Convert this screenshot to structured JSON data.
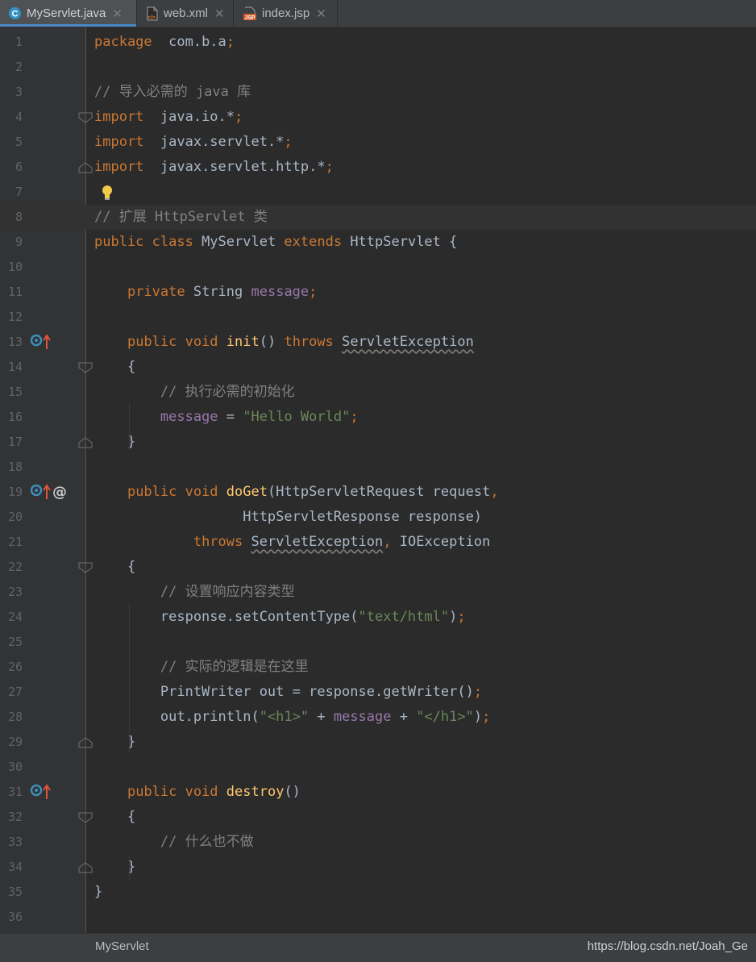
{
  "tabs": [
    {
      "label": "MyServlet.java",
      "icon": "java-class-icon",
      "active": true
    },
    {
      "label": "web.xml",
      "icon": "xml-file-icon",
      "active": false
    },
    {
      "label": "index.jsp",
      "icon": "jsp-file-icon",
      "active": false
    }
  ],
  "editor": {
    "line_numbers": [
      "1",
      "2",
      "3",
      "4",
      "5",
      "6",
      "7",
      "8",
      "9",
      "10",
      "11",
      "12",
      "13",
      "14",
      "15",
      "16",
      "17",
      "18",
      "19",
      "20",
      "21",
      "22",
      "23",
      "24",
      "25",
      "26",
      "27",
      "28",
      "29",
      "30",
      "31",
      "32",
      "33",
      "34",
      "35",
      "36"
    ],
    "current_line": 8,
    "lines": [
      [
        [
          "kw",
          "package"
        ],
        [
          "",
          "  com.b.a"
        ],
        [
          "kw",
          ";"
        ]
      ],
      [],
      [
        [
          "cm",
          "// 导入必需的 java 库"
        ]
      ],
      [
        [
          "kw",
          "import"
        ],
        [
          "",
          "  java.io.*"
        ],
        [
          "kw",
          ";"
        ]
      ],
      [
        [
          "kw",
          "import"
        ],
        [
          "",
          "  javax.servlet.*"
        ],
        [
          "kw",
          ";"
        ]
      ],
      [
        [
          "kw",
          "import"
        ],
        [
          "",
          "  javax.servlet.http.*"
        ],
        [
          "kw",
          ";"
        ]
      ],
      [],
      [
        [
          "cm",
          "// 扩展 HttpServlet 类"
        ]
      ],
      [
        [
          "kw",
          "public class "
        ],
        [
          "",
          "MyServlet "
        ],
        [
          "kw",
          "extends "
        ],
        [
          "",
          "HttpServlet {"
        ]
      ],
      [],
      [
        [
          "",
          "    "
        ],
        [
          "kw",
          "private "
        ],
        [
          "",
          "String "
        ],
        [
          "fld",
          "message"
        ],
        [
          "kw",
          ";"
        ]
      ],
      [],
      [
        [
          "",
          "    "
        ],
        [
          "kw",
          "public void "
        ],
        [
          "fn",
          "init"
        ],
        [
          "",
          "() "
        ],
        [
          "kw",
          "throws "
        ],
        [
          "sq",
          "ServletException"
        ]
      ],
      [
        [
          "",
          "    {"
        ]
      ],
      [
        [
          "",
          "        "
        ],
        [
          "cm",
          "// 执行必需的初始化"
        ]
      ],
      [
        [
          "",
          "        "
        ],
        [
          "fld",
          "message"
        ],
        [
          "",
          " = "
        ],
        [
          "str",
          "\"Hello World\""
        ],
        [
          "kw",
          ";"
        ]
      ],
      [
        [
          "",
          "    }"
        ]
      ],
      [],
      [
        [
          "",
          "    "
        ],
        [
          "kw",
          "public void "
        ],
        [
          "fn",
          "doGet"
        ],
        [
          "",
          "(HttpServletRequest request"
        ],
        [
          "kw",
          ","
        ]
      ],
      [
        [
          "",
          "                  HttpServletResponse response)"
        ]
      ],
      [
        [
          "",
          "            "
        ],
        [
          "kw",
          "throws "
        ],
        [
          "sq",
          "ServletException"
        ],
        [
          "kw",
          ", "
        ],
        [
          "",
          "IOException"
        ]
      ],
      [
        [
          "",
          "    {"
        ]
      ],
      [
        [
          "",
          "        "
        ],
        [
          "cm",
          "// 设置响应内容类型"
        ]
      ],
      [
        [
          "",
          "        response.setContentType("
        ],
        [
          "str",
          "\"text/html\""
        ],
        [
          "",
          ")"
        ],
        [
          "kw",
          ";"
        ]
      ],
      [],
      [
        [
          "",
          "        "
        ],
        [
          "cm",
          "// 实际的逻辑是在这里"
        ]
      ],
      [
        [
          "",
          "        PrintWriter out = response.getWriter()"
        ],
        [
          "kw",
          ";"
        ]
      ],
      [
        [
          "",
          "        out.println("
        ],
        [
          "str",
          "\"<h1>\""
        ],
        [
          "",
          " + "
        ],
        [
          "fld",
          "message"
        ],
        [
          "",
          " + "
        ],
        [
          "str",
          "\"</h1>\""
        ],
        [
          "",
          ")"
        ],
        [
          "kw",
          ";"
        ]
      ],
      [
        [
          "",
          "    }"
        ]
      ],
      [],
      [
        [
          "",
          "    "
        ],
        [
          "kw",
          "public void "
        ],
        [
          "fn",
          "destroy"
        ],
        [
          "",
          "()"
        ]
      ],
      [
        [
          "",
          "    {"
        ]
      ],
      [
        [
          "",
          "        "
        ],
        [
          "cm",
          "// 什么也不做"
        ]
      ],
      [
        [
          "",
          "    }"
        ]
      ],
      [
        [
          "",
          "}"
        ]
      ],
      []
    ],
    "gutter_markers": [
      {
        "line": 13,
        "icons": [
          "override-circle-icon",
          "implements-up-arrow-icon"
        ]
      },
      {
        "line": 19,
        "icons": [
          "override-circle-icon",
          "implements-up-arrow-icon",
          "annotation-at-icon"
        ]
      },
      {
        "line": 31,
        "icons": [
          "override-circle-icon",
          "implements-up-arrow-icon"
        ]
      }
    ],
    "fold_markers": [
      {
        "line": 4,
        "type": "start"
      },
      {
        "line": 6,
        "type": "end"
      },
      {
        "line": 14,
        "type": "start"
      },
      {
        "line": 17,
        "type": "end"
      },
      {
        "line": 22,
        "type": "start"
      },
      {
        "line": 29,
        "type": "end"
      },
      {
        "line": 32,
        "type": "start"
      },
      {
        "line": 34,
        "type": "end"
      }
    ],
    "intention_bulb_line": 7,
    "colors": {
      "background": "#2b2b2b",
      "gutter": "#313335",
      "keyword": "#cc7832",
      "comment": "#808080",
      "string": "#6a8759",
      "field": "#9876aa",
      "method": "#ffc66d",
      "text": "#a9b7c6",
      "line_number": "#606366"
    }
  },
  "status": {
    "breadcrumb": "MyServlet",
    "watermark": "https://blog.csdn.net/Joah_Ge"
  }
}
